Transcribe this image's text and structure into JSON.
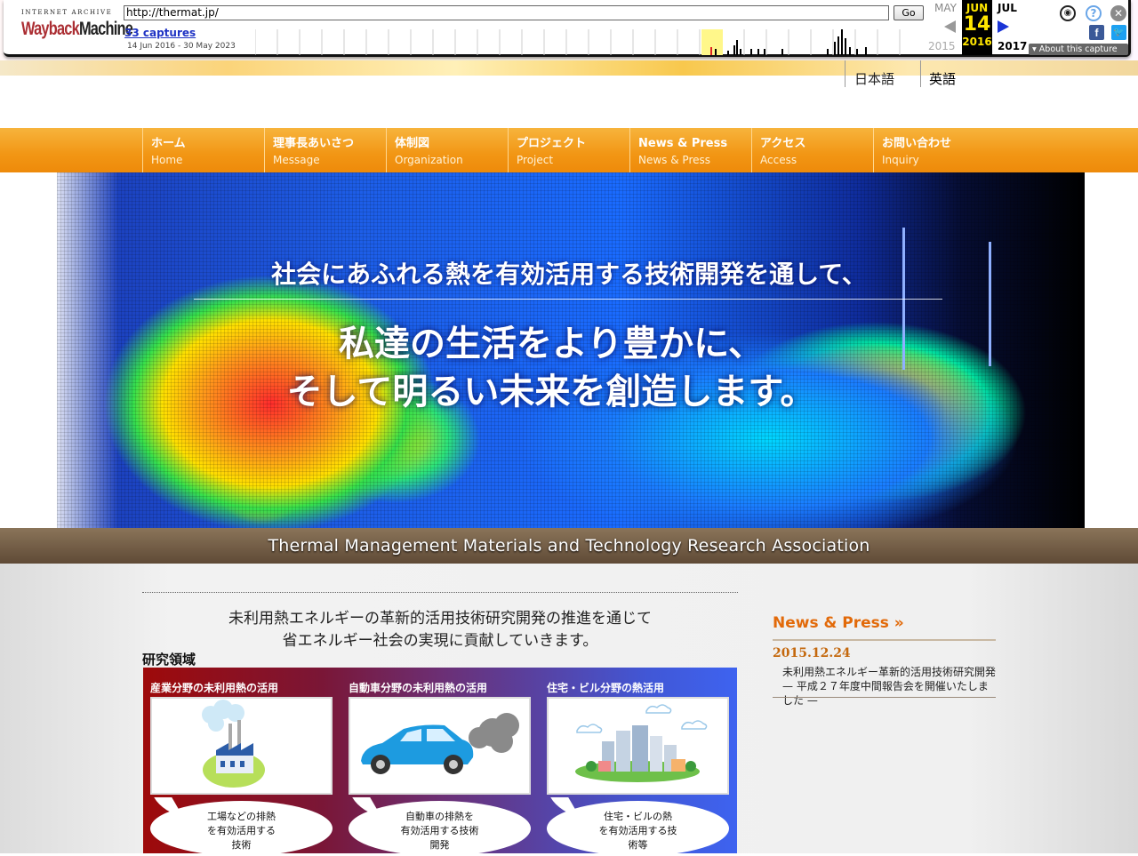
{
  "wayback": {
    "logo_top": "INTERNET ARCHIVE",
    "logo_a": "Wayback",
    "logo_b": "Machine",
    "url": "http://thermat.jp/",
    "go": "Go",
    "captures": "33 captures",
    "range": "14 Jun 2016 - 30 May 2023",
    "prev_month": "MAY",
    "cur_month": "JUN",
    "cur_day": "14",
    "cur_year": "2016",
    "next_month": "JUL",
    "prev_year": "2015",
    "next_year": "2017",
    "about": "About this capture",
    "facebook": "f",
    "twitter": "t"
  },
  "header": {
    "lang_jp": "日本語",
    "lang_en": "英語"
  },
  "nav": [
    {
      "jp": "ホーム",
      "en": "Home"
    },
    {
      "jp": "理事長あいさつ",
      "en": "Message"
    },
    {
      "jp": "体制図",
      "en": "Organization"
    },
    {
      "jp": "プロジェクト",
      "en": "Project"
    },
    {
      "jp": "News & Press",
      "en": "News & Press"
    },
    {
      "jp": "アクセス",
      "en": "Access"
    },
    {
      "jp": "お問い合わせ",
      "en": "Inquiry"
    }
  ],
  "hero": {
    "line1": "社会にあふれる熱を有効活用する技術開発を通して、",
    "line2": "私達の生活をより豊かに、",
    "line3": "そして明るい未来を創造します。"
  },
  "band": "Thermal Management Materials and Technology Research Association",
  "main": {
    "intro1": "未利用熱エネルギーの革新的活用技術研究開発の推進を通じて",
    "intro2": "省エネルギー社会の実現に貢献していきます。",
    "section": "研究領域",
    "cards": [
      {
        "title": "産業分野の未利用熱の活用",
        "bubble": [
          "工場などの排熱",
          "を有効活用する",
          "技術"
        ]
      },
      {
        "title": "自動車分野の未利用熱の活用",
        "bubble": [
          "自動車の排熱を",
          "有効活用する技術",
          "開発"
        ]
      },
      {
        "title": "住宅・ビル分野の熱活用",
        "bubble": [
          "住宅・ビルの熱",
          "を有効活用する技",
          "術等"
        ]
      }
    ]
  },
  "news": {
    "heading": "News & Press",
    "date": "2015.12.24",
    "text": "未利用熱エネルギー革新的活用技術研究開発 — 平成２７年度中間報告会を開催いたしました —"
  }
}
